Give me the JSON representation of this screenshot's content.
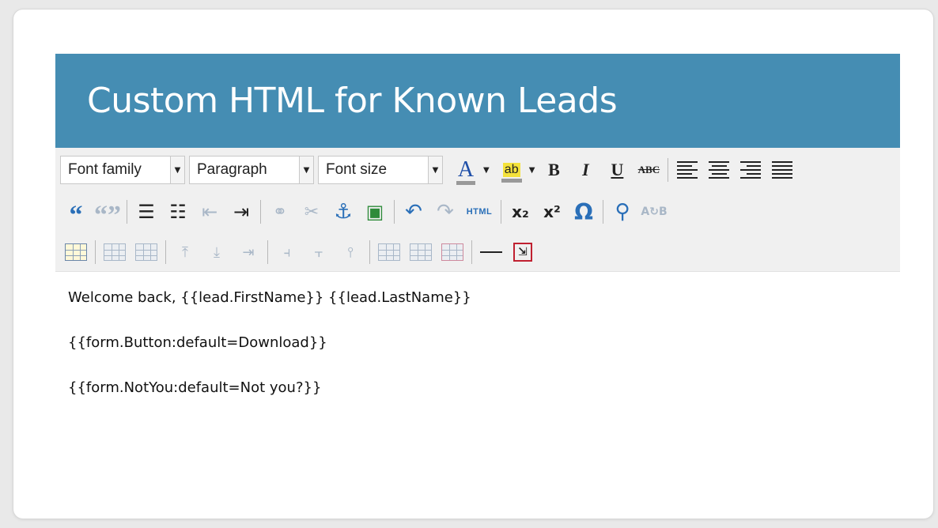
{
  "dialog": {
    "title": "Custom HTML for Known Leads"
  },
  "toolbar": {
    "font_family": {
      "selected": "Font family"
    },
    "format": {
      "selected": "Paragraph"
    },
    "font_size": {
      "selected": "Font size"
    },
    "text_color_glyph": "A",
    "highlight_glyph": "ab",
    "bold_glyph": "B",
    "italic_glyph": "I",
    "underline_glyph": "U",
    "strike_glyph": "ABC",
    "html_label": "HTML",
    "icons": [
      "text-color-icon",
      "background-color-icon",
      "bold-icon",
      "italic-icon",
      "underline-icon",
      "strikethrough-icon",
      "align-left-icon",
      "align-center-icon",
      "align-right-icon",
      "align-justify-icon",
      "blockquote-icon",
      "unquote-icon",
      "bullet-list-icon",
      "numbered-list-icon",
      "outdent-icon",
      "indent-icon",
      "link-icon",
      "unlink-icon",
      "anchor-icon",
      "image-icon",
      "undo-icon",
      "redo-icon",
      "html-source-icon",
      "subscript-icon",
      "superscript-icon",
      "special-char-icon",
      "find-icon",
      "replace-icon",
      "table-icon",
      "row-props-icon",
      "cell-props-icon",
      "insert-row-before-icon",
      "insert-row-after-icon",
      "delete-row-icon",
      "insert-col-before-icon",
      "insert-col-after-icon",
      "delete-col-icon",
      "split-cells-icon",
      "merge-cells-icon",
      "delete-table-icon",
      "horizontal-rule-icon",
      "page-break-icon"
    ]
  },
  "content": {
    "lines": [
      "Welcome back, {{lead.FirstName}} {{lead.LastName}}",
      "{{form.Button:default=Download}}",
      "{{form.NotYou:default=Not you?}}"
    ]
  },
  "colors": {
    "title_bar": "#458db3",
    "toolbar_bg": "#f0f0f0",
    "icon_blue": "#2a6fb8"
  }
}
